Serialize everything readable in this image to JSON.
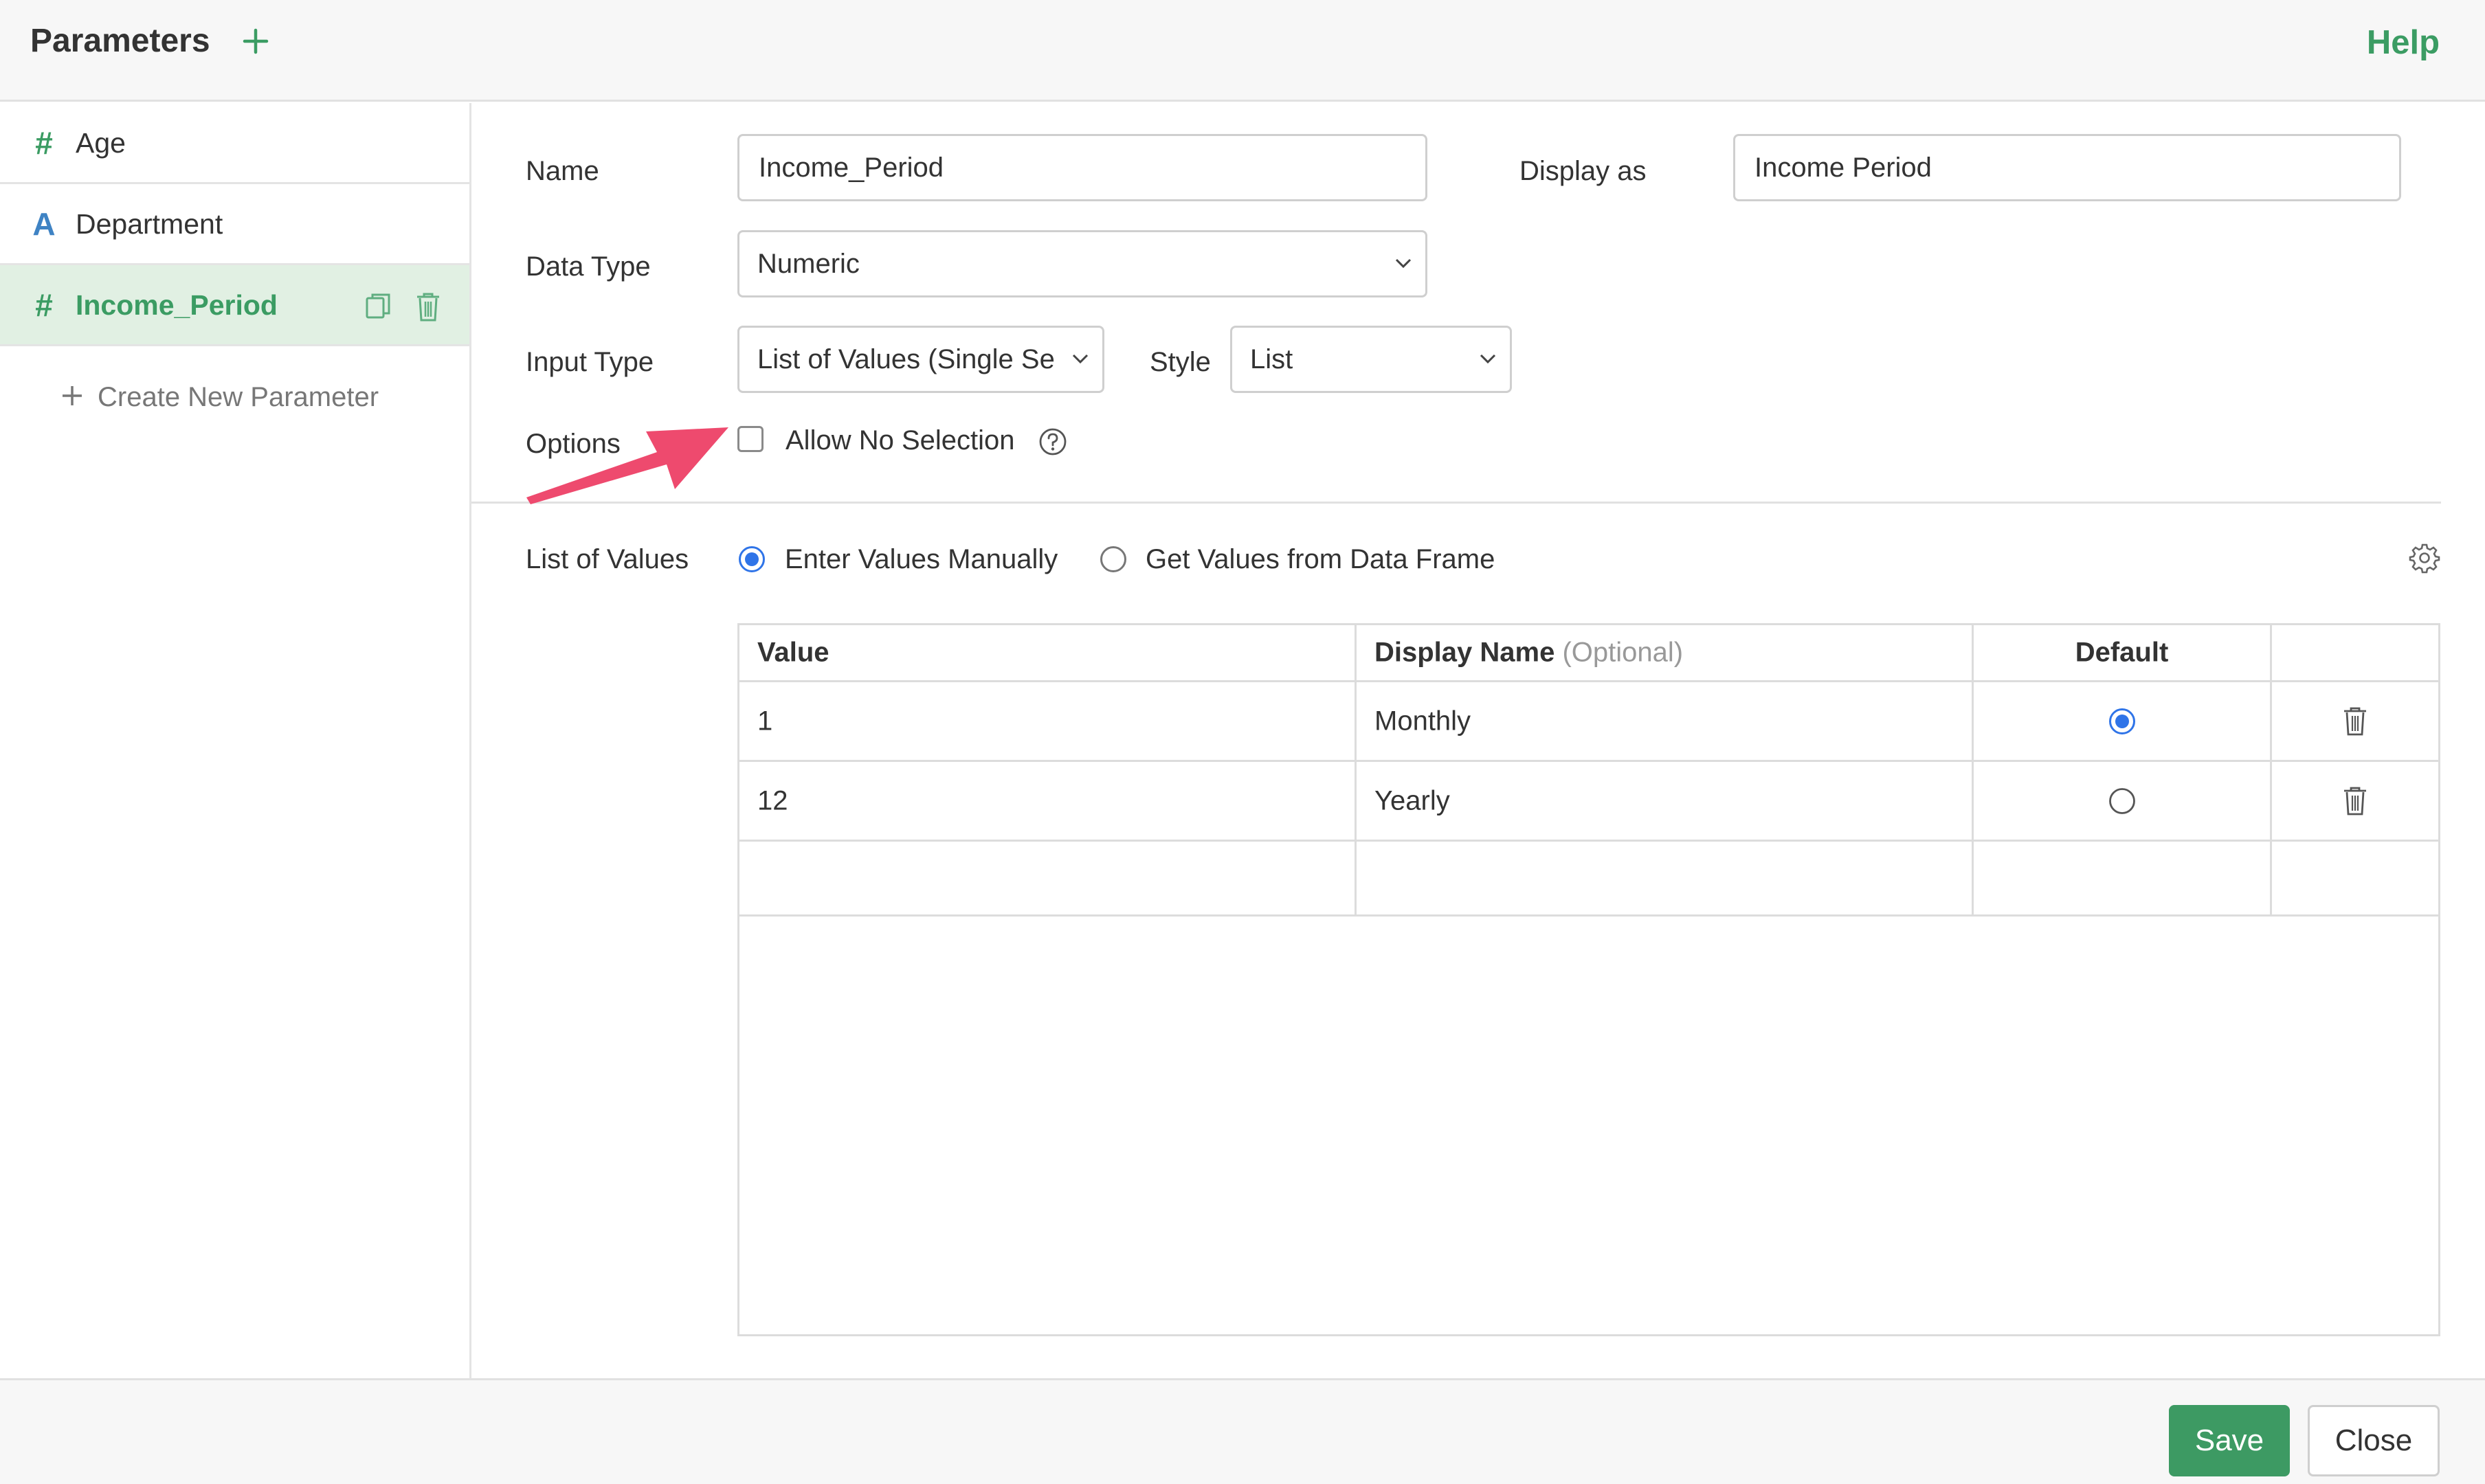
{
  "header": {
    "title": "Parameters",
    "help_label": "Help"
  },
  "sidebar": {
    "items": [
      {
        "icon": "#",
        "label": "Age",
        "type": "numeric"
      },
      {
        "icon": "A",
        "label": "Department",
        "type": "character"
      },
      {
        "icon": "#",
        "label": "Income_Period",
        "type": "numeric",
        "active": true
      }
    ],
    "create_new_label": "Create New Parameter"
  },
  "form": {
    "name_label": "Name",
    "name_value": "Income_Period",
    "display_as_label": "Display as",
    "display_as_value": "Income Period",
    "data_type_label": "Data Type",
    "data_type_value": "Numeric",
    "input_type_label": "Input Type",
    "input_type_value": "List of Values (Single Se",
    "style_label": "Style",
    "style_value": "List",
    "options_label": "Options",
    "allow_no_selection_label": "Allow No Selection",
    "allow_no_selection_checked": false,
    "list_of_values_label": "List of Values",
    "enter_manually_label": "Enter Values Manually",
    "from_data_frame_label": "Get Values from Data Frame",
    "values_source_selected": "Enter Values Manually"
  },
  "values_table": {
    "headers": {
      "value": "Value",
      "display_name": "Display Name",
      "display_name_hint": "(Optional)",
      "default": "Default"
    },
    "rows": [
      {
        "value": "1",
        "display_name": "Monthly",
        "default": true
      },
      {
        "value": "12",
        "display_name": "Yearly",
        "default": false
      }
    ]
  },
  "footer": {
    "save_label": "Save",
    "close_label": "Close"
  },
  "colors": {
    "accent_green": "#3b9c63",
    "accent_blue": "#2f74e8",
    "annotation_pink": "#ee4a6e"
  }
}
